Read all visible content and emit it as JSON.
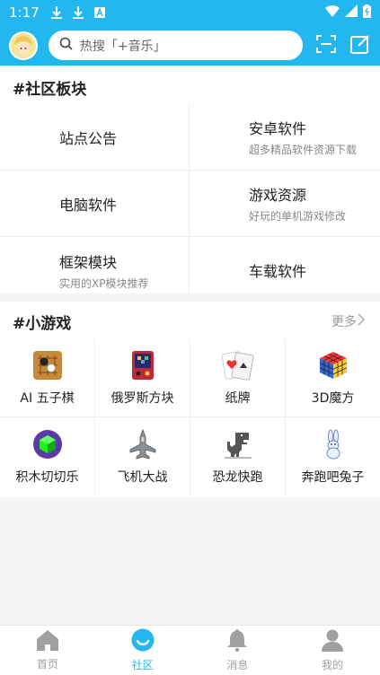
{
  "status_bar": {
    "time": "1:17"
  },
  "header": {
    "search_placeholder": "热搜「+音乐」"
  },
  "forum_section": {
    "title": "#社区板块",
    "items": [
      {
        "title": "站点公告",
        "subtitle": ""
      },
      {
        "title": "安卓软件",
        "subtitle": "超多精品软件资源下载"
      },
      {
        "title": "电脑软件",
        "subtitle": ""
      },
      {
        "title": "游戏资源",
        "subtitle": "好玩的单机游戏修改"
      },
      {
        "title": "框架模块",
        "subtitle": "实用的XP模块推荐"
      },
      {
        "title": "车载软件",
        "subtitle": ""
      }
    ]
  },
  "games_section": {
    "title": "#小游戏",
    "more_label": "更多",
    "items": [
      {
        "name": "AI 五子棋",
        "icon": "gomoku-icon"
      },
      {
        "name": "俄罗斯方块",
        "icon": "tetris-icon"
      },
      {
        "name": "纸牌",
        "icon": "cards-icon"
      },
      {
        "name": "3D魔方",
        "icon": "rubiks-cube-icon"
      },
      {
        "name": "积木切切乐",
        "icon": "block-cut-icon"
      },
      {
        "name": "飞机大战",
        "icon": "airplane-icon"
      },
      {
        "name": "恐龙快跑",
        "icon": "dinosaur-icon"
      },
      {
        "name": "奔跑吧兔子",
        "icon": "rabbit-icon"
      }
    ]
  },
  "bottom_nav": {
    "items": [
      {
        "label": "首页",
        "icon": "home-icon",
        "active": false
      },
      {
        "label": "社区",
        "icon": "community-icon",
        "active": true
      },
      {
        "label": "消息",
        "icon": "bell-icon",
        "active": false
      },
      {
        "label": "我的",
        "icon": "person-icon",
        "active": false
      }
    ]
  },
  "colors": {
    "accent": "#22b8ef",
    "inactive": "#a0a0a0"
  }
}
